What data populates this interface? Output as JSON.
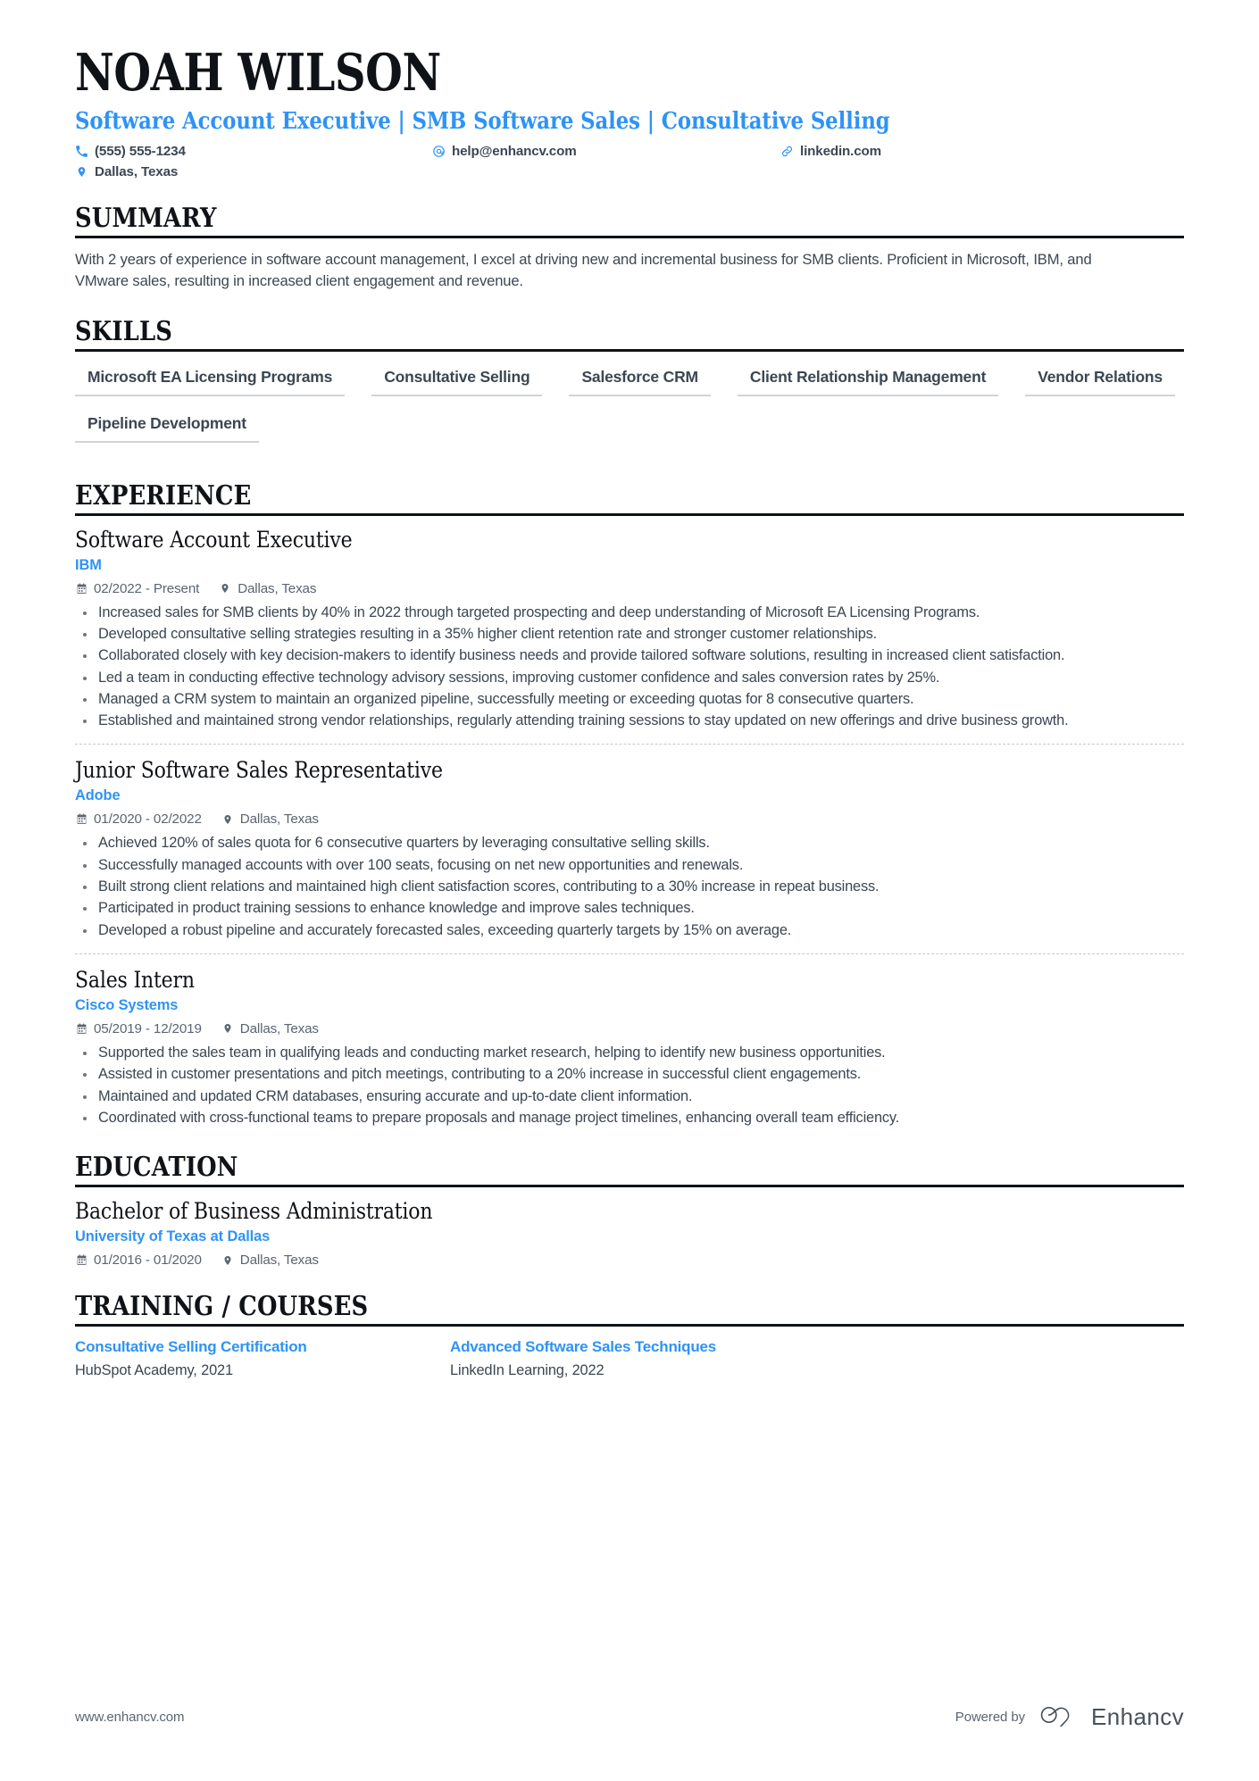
{
  "document_type": "resume",
  "accent_color": "#2e93f5",
  "text_color": "#3c4653",
  "heading_color": "#0f1216",
  "header": {
    "full_name": "NOAH WILSON",
    "headline": "Software Account Executive | SMB Software Sales | Consultative Selling",
    "contacts": [
      {
        "icon": "phone-icon",
        "label": "(555) 555-1234"
      },
      {
        "icon": "email-icon",
        "label": "help@enhancv.com"
      },
      {
        "icon": "link-icon",
        "label": "linkedin.com"
      },
      {
        "icon": "location-icon",
        "label": "Dallas, Texas"
      }
    ]
  },
  "sections": {
    "summary": {
      "title": "SUMMARY",
      "text": "With 2 years of experience in software account management, I excel at driving new and incremental business for SMB clients. Proficient in Microsoft, IBM, and VMware sales, resulting in increased client engagement and revenue."
    },
    "skills": {
      "title": "SKILLS",
      "items": [
        "Microsoft EA Licensing Programs",
        "Consultative Selling",
        "Salesforce CRM",
        "Client Relationship Management",
        "Vendor Relations",
        "Pipeline Development"
      ]
    },
    "experience": {
      "title": "EXPERIENCE",
      "entries": [
        {
          "title": "Software Account Executive",
          "organization": "IBM",
          "dates": "02/2022 - Present",
          "location": "Dallas, Texas",
          "bullets": [
            "Increased sales for SMB clients by 40% in 2022 through targeted prospecting and deep understanding of Microsoft EA Licensing Programs.",
            "Developed consultative selling strategies resulting in a 35% higher client retention rate and stronger customer relationships.",
            "Collaborated closely with key decision-makers to identify business needs and provide tailored software solutions, resulting in increased client satisfaction.",
            "Led a team in conducting effective technology advisory sessions, improving customer confidence and sales conversion rates by 25%.",
            "Managed a CRM system to maintain an organized pipeline, successfully meeting or exceeding quotas for 8 consecutive quarters.",
            "Established and maintained strong vendor relationships, regularly attending training sessions to stay updated on new offerings and drive business growth."
          ]
        },
        {
          "title": "Junior Software Sales Representative",
          "organization": "Adobe",
          "dates": "01/2020 - 02/2022",
          "location": "Dallas, Texas",
          "bullets": [
            "Achieved 120% of sales quota for 6 consecutive quarters by leveraging consultative selling skills.",
            "Successfully managed accounts with over 100 seats, focusing on net new opportunities and renewals.",
            "Built strong client relations and maintained high client satisfaction scores, contributing to a 30% increase in repeat business.",
            "Participated in product training sessions to enhance knowledge and improve sales techniques.",
            "Developed a robust pipeline and accurately forecasted sales, exceeding quarterly targets by 15% on average."
          ]
        },
        {
          "title": "Sales Intern",
          "organization": "Cisco Systems",
          "dates": "05/2019 - 12/2019",
          "location": "Dallas, Texas",
          "bullets": [
            "Supported the sales team in qualifying leads and conducting market research, helping to identify new business opportunities.",
            "Assisted in customer presentations and pitch meetings, contributing to a 20% increase in successful client engagements.",
            "Maintained and updated CRM databases, ensuring accurate and up-to-date client information.",
            "Coordinated with cross-functional teams to prepare proposals and manage project timelines, enhancing overall team efficiency."
          ]
        }
      ]
    },
    "education": {
      "title": "EDUCATION",
      "entries": [
        {
          "title": "Bachelor of Business Administration",
          "organization": "University of Texas at Dallas",
          "dates": "01/2016 - 01/2020",
          "location": "Dallas, Texas"
        }
      ]
    },
    "courses": {
      "title": "TRAINING / COURSES",
      "entries": [
        {
          "name": "Consultative Selling Certification",
          "provider": "HubSpot Academy, 2021"
        },
        {
          "name": "Advanced Software Sales Techniques",
          "provider": "LinkedIn Learning, 2022"
        }
      ]
    }
  },
  "footer": {
    "url": "www.enhancv.com",
    "powered_by": "Powered by",
    "brand": "Enhancv"
  }
}
